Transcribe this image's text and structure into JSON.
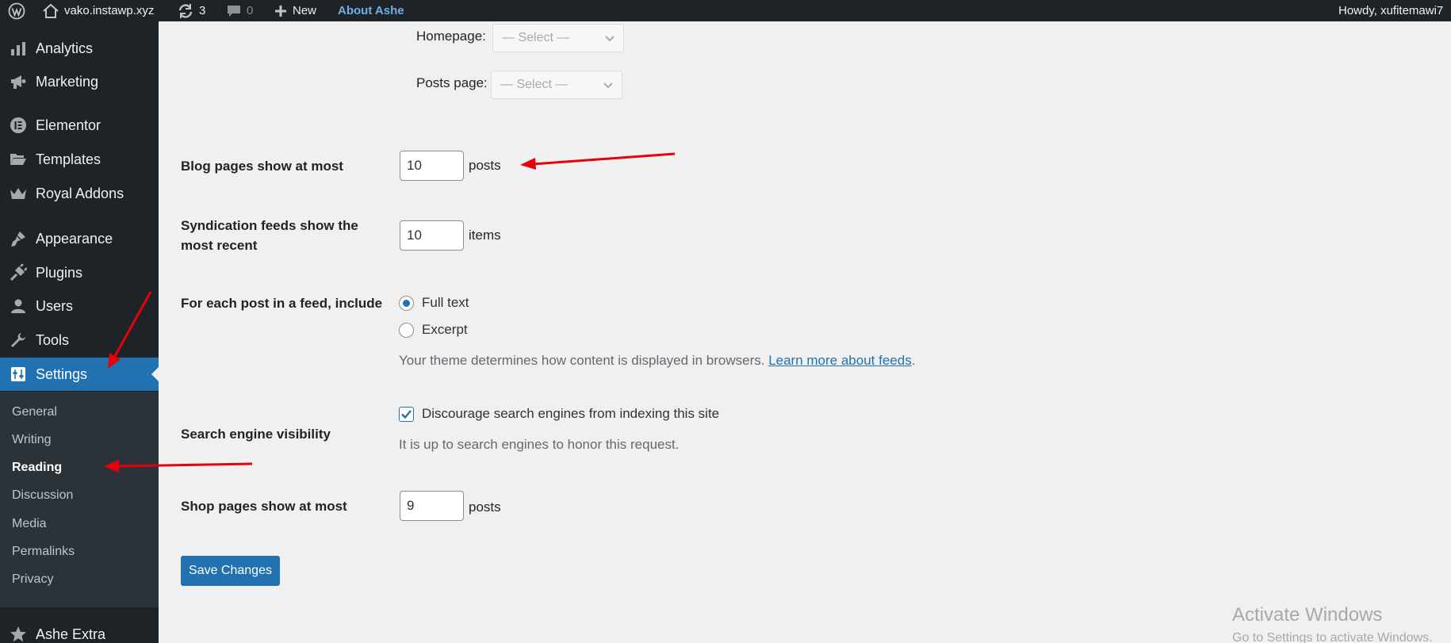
{
  "adminbar": {
    "site_name": "vako.instawp.xyz",
    "updates_count": "3",
    "comments_count": "0",
    "new_label": "New",
    "about_label": "About Ashe",
    "howdy": "Howdy, xufitemawi7"
  },
  "sidebar": {
    "items": [
      {
        "label": "Analytics",
        "icon": "bar-chart-icon"
      },
      {
        "label": "Marketing",
        "icon": "megaphone-icon"
      },
      {
        "label": "Elementor",
        "icon": "elementor-icon"
      },
      {
        "label": "Templates",
        "icon": "folder-icon"
      },
      {
        "label": "Royal Addons",
        "icon": "crown-icon"
      },
      {
        "label": "Appearance",
        "icon": "paintbrush-icon"
      },
      {
        "label": "Plugins",
        "icon": "plug-icon"
      },
      {
        "label": "Users",
        "icon": "user-icon"
      },
      {
        "label": "Tools",
        "icon": "wrench-icon"
      },
      {
        "label": "Settings",
        "icon": "settings-sliders-icon"
      },
      {
        "label": "Ashe Extra",
        "icon": "star-icon"
      }
    ],
    "submenu": [
      "General",
      "Writing",
      "Reading",
      "Discussion",
      "Media",
      "Permalinks",
      "Privacy"
    ],
    "active_submenu": "Reading"
  },
  "form": {
    "homepage_label": "Homepage:",
    "posts_page_label": "Posts page:",
    "select_placeholder": "— Select —",
    "blog_pages": {
      "label": "Blog pages show at most",
      "value": "10",
      "suffix": "posts"
    },
    "syndication": {
      "label_line1": "Syndication feeds show the",
      "label_line2": "most recent",
      "value": "10",
      "suffix": "items"
    },
    "feed_include": {
      "label": "For each post in a feed, include",
      "options": [
        "Full text",
        "Excerpt"
      ],
      "selected": "Full text",
      "description": "Your theme determines how content is displayed in browsers.",
      "link_text": "Learn more about feeds",
      "after_link": "."
    },
    "search_visibility": {
      "label": "Search engine visibility",
      "checkbox_label": "Discourage search engines from indexing this site",
      "checked": true,
      "description": "It is up to search engines to honor this request."
    },
    "shop_pages": {
      "label": "Shop pages show at most",
      "value": "9",
      "suffix": "posts"
    },
    "save_label": "Save Changes"
  },
  "watermark": {
    "title": "Activate Windows",
    "subtitle": "Go to Settings to activate Windows."
  },
  "colors": {
    "admin_dark": "#1d2327",
    "accent": "#2271b1",
    "annotation_red": "#e8000b"
  }
}
